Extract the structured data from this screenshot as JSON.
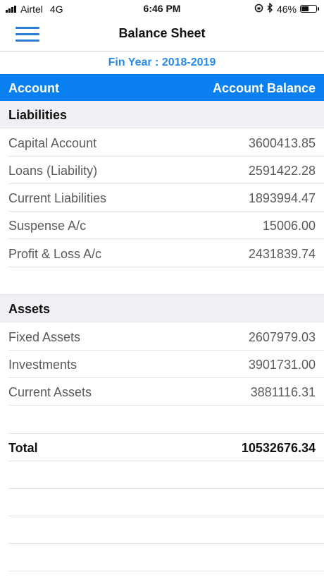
{
  "status_bar": {
    "carrier": "Airtel",
    "network": "4G",
    "time": "6:46 PM",
    "battery_pct": "46%",
    "icons": [
      "signal-icon",
      "lock-rotation-icon",
      "bluetooth-icon",
      "battery-icon"
    ]
  },
  "nav": {
    "title": "Balance Sheet",
    "menu_icon": "hamburger-menu-icon"
  },
  "fin_year": "Fin Year : 2018-2019",
  "table": {
    "col_account": "Account",
    "col_balance": "Account Balance"
  },
  "liabilities": {
    "heading": "Liabilities",
    "rows": [
      {
        "name": "Capital Account",
        "value": "3600413.85"
      },
      {
        "name": "Loans (Liability)",
        "value": "2591422.28"
      },
      {
        "name": "Current Liabilities",
        "value": "1893994.47"
      },
      {
        "name": "Suspense A/c",
        "value": "15006.00"
      },
      {
        "name": "Profit & Loss A/c",
        "value": "2431839.74"
      }
    ]
  },
  "assets": {
    "heading": "Assets",
    "rows": [
      {
        "name": "Fixed Assets",
        "value": "2607979.03"
      },
      {
        "name": "Investments",
        "value": "3901731.00"
      },
      {
        "name": "Current Assets",
        "value": "3881116.31"
      }
    ]
  },
  "total": {
    "label": "Total",
    "value": "10532676.34"
  },
  "colors": {
    "accent": "#0a80f0",
    "fin_year": "#2a8ae8",
    "section_bg": "#efeff4"
  }
}
